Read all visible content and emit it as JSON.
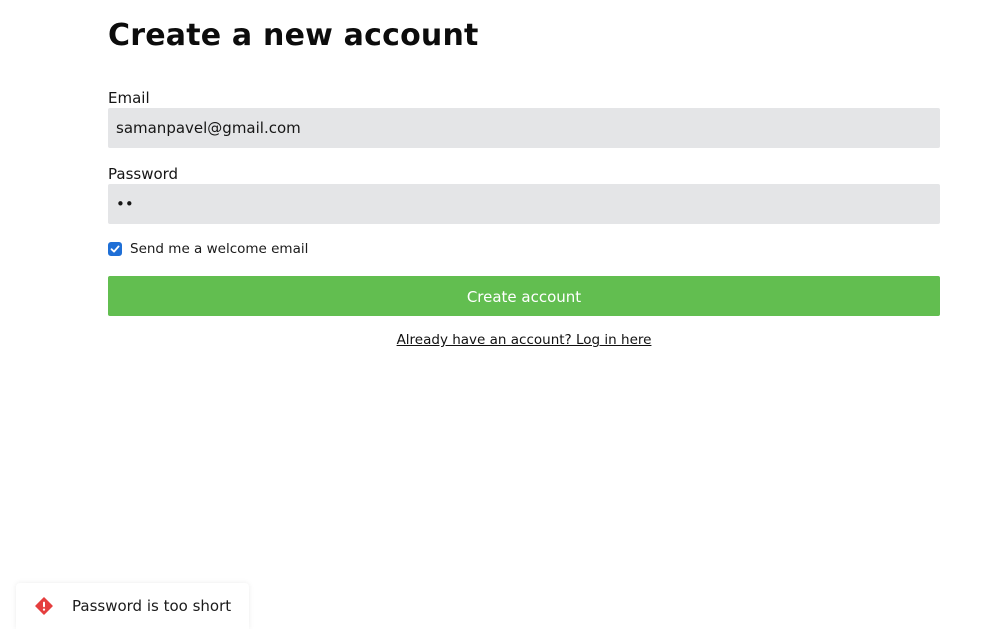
{
  "page": {
    "title": "Create a new account"
  },
  "form": {
    "email": {
      "label": "Email",
      "value": "samanpavel@gmail.com"
    },
    "password": {
      "label": "Password",
      "value": "••"
    },
    "welcome_email": {
      "label": "Send me a welcome email",
      "checked": true
    },
    "submit_label": "Create account",
    "login_link_text": "Already have an account? Log in here"
  },
  "toast": {
    "icon": "alert-icon",
    "message": "Password is too short",
    "color": "#e53e3e"
  },
  "colors": {
    "primary_button": "#62be50",
    "input_background": "#e4e5e7",
    "checkbox_accent": "#1f6fd6"
  }
}
